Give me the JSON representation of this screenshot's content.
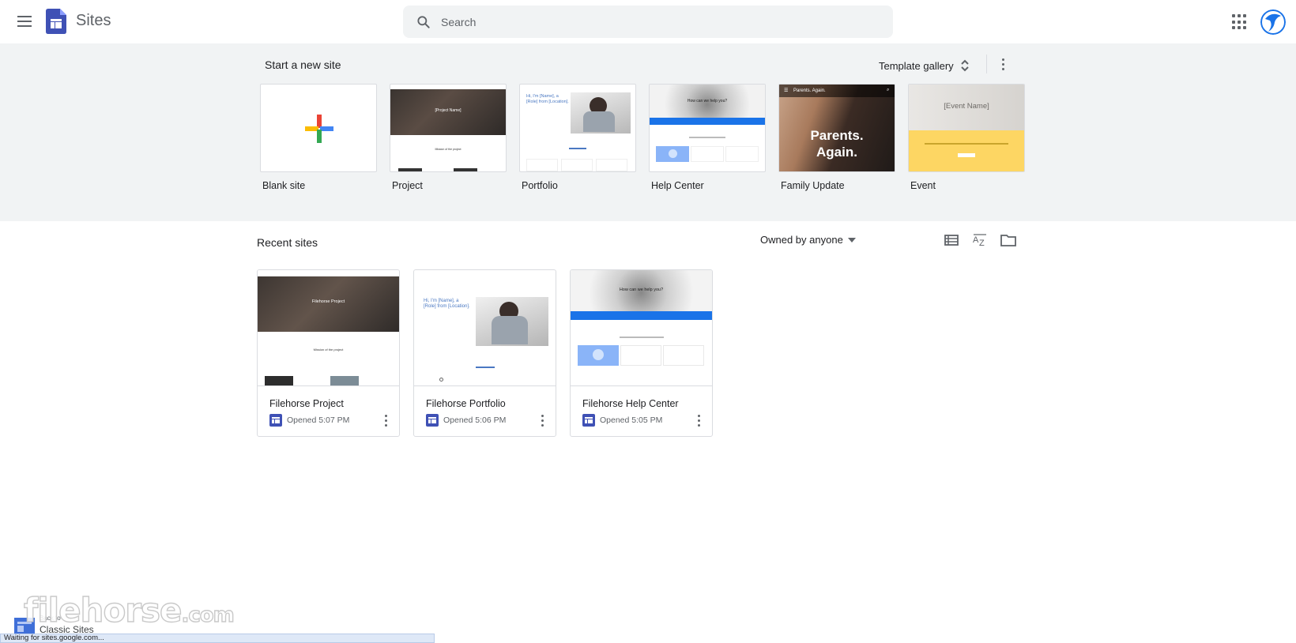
{
  "header": {
    "app_name": "Sites",
    "search_placeholder": "Search"
  },
  "templates": {
    "title": "Start a new site",
    "gallery_label": "Template gallery",
    "items": [
      {
        "label": "Blank site"
      },
      {
        "label": "Project",
        "thumb_title": "[Project Name]",
        "thumb_sub": "Mission of the project"
      },
      {
        "label": "Portfolio",
        "thumb_title": "Hi, I'm [Name], a [Role] from [Location]."
      },
      {
        "label": "Help Center",
        "thumb_title": "How can we help you?"
      },
      {
        "label": "Family Update",
        "thumb_header": "Parents. Again.",
        "thumb_title": "Parents. Again."
      },
      {
        "label": "Event",
        "thumb_title": "[Event Name]"
      }
    ]
  },
  "recent": {
    "title": "Recent sites",
    "owner_filter": "Owned by anyone",
    "sites": [
      {
        "name": "Filehorse Project",
        "opened": "Opened 5:07 PM",
        "thumb_title": "Filehorse Project",
        "thumb_sub": "Mission of the project"
      },
      {
        "name": "Filehorse Portfolio",
        "opened": "Opened 5:06 PM",
        "thumb_title": "Hi, I'm [Name], a [Role] from [Location]."
      },
      {
        "name": "Filehorse Help Center",
        "opened": "Opened 5:05 PM",
        "thumb_title": "How can we help you?"
      }
    ]
  },
  "footer": {
    "watermark": "filehorse",
    "watermark_tld": ".com",
    "classic_small": "Back to",
    "classic_big": "Classic Sites",
    "status": "Waiting for sites.google.com..."
  },
  "colors": {
    "accent": "#1a73e8",
    "sites_brand": "#3f51b5",
    "band_bg": "#f1f3f4",
    "event_yellow": "#fdd663"
  }
}
